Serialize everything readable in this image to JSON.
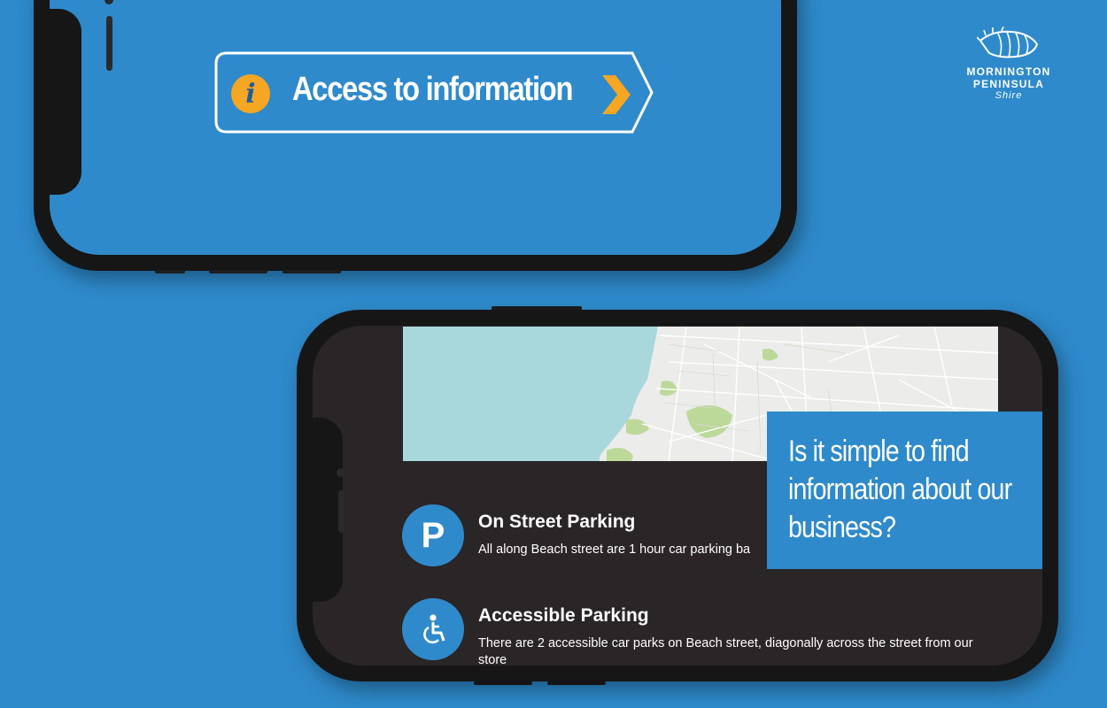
{
  "top_phone": {
    "access_button": {
      "label": "Access to information",
      "icon": "info-icon",
      "chevron": "chevron-right-icon"
    }
  },
  "logo": {
    "line1": "MORNINGTON",
    "line2": "PENINSULA",
    "line3": "Shire"
  },
  "bottom_phone": {
    "map_label": "Map",
    "parking": [
      {
        "title": "On Street Parking",
        "description": "All along Beach street are 1 hour car parking ba",
        "icon": "parking-p-icon"
      },
      {
        "title": "Accessible Parking",
        "description": "There are 2 accessible car parks on Beach street, diagonally across the street from our store",
        "icon": "wheelchair-icon"
      }
    ]
  },
  "question_box": {
    "text": "Is it simple to find information about our business?"
  },
  "colors": {
    "background": "#2e8acb",
    "accent": "#f5a623",
    "phone_body": "#161616",
    "screen_dark": "#2a2526"
  }
}
